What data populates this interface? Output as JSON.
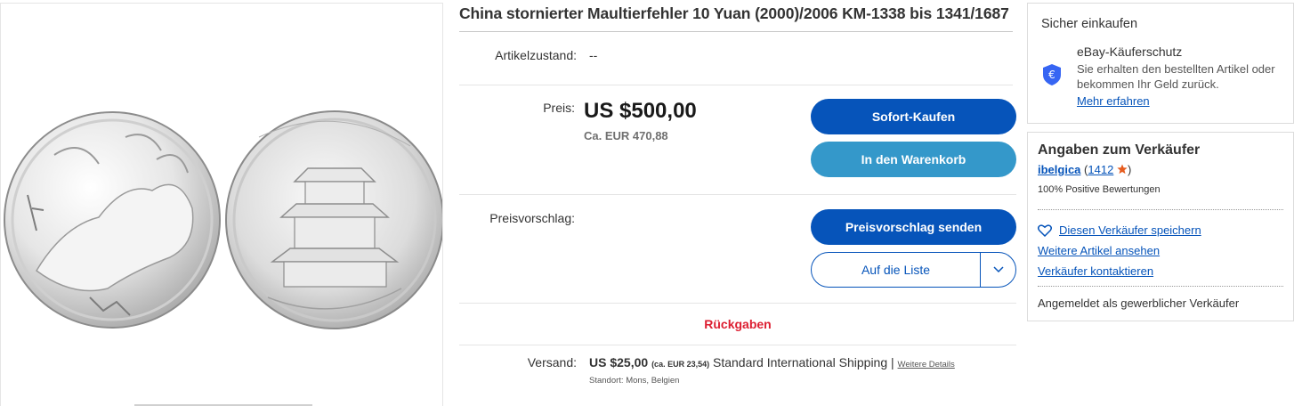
{
  "title": "China stornierter Maultierfehler 10 Yuan (2000)/2006 KM-1338 bis 1341/1687",
  "condition": {
    "label": "Artikelzustand:",
    "value": "--"
  },
  "price": {
    "label": "Preis:",
    "main": "US $500,00",
    "converted": "Ca. EUR 470,88"
  },
  "buttons": {
    "buy_now": "Sofort-Kaufen",
    "add_to_cart": "In den Warenkorb",
    "make_offer": "Preisvorschlag senden",
    "watchlist": "Auf die Liste"
  },
  "offer": {
    "label": "Preisvorschlag:"
  },
  "returns": "Rückgaben",
  "shipping": {
    "label": "Versand:",
    "amount": "US $25,00",
    "converted": "(ca. EUR 23,54)",
    "method": "Standard International Shipping |",
    "details_link": "Weitere Details",
    "location": "Standort: Mons, Belgien"
  },
  "secure": {
    "heading": "Sicher einkaufen",
    "title": "eBay-Käuferschutz",
    "text": "Sie erhalten den bestellten Artikel oder bekommen Ihr Geld zurück.",
    "link": "Mehr erfahren",
    "shield_symbol": "€"
  },
  "seller": {
    "heading": "Angaben zum Verkäufer",
    "name": "ibelgica",
    "open_paren": "(",
    "feedback": "1412",
    "close_paren": ")",
    "positive": "100% Positive Bewertungen",
    "save": "Diesen Verkäufer speichern",
    "more_items": "Weitere Artikel ansehen",
    "contact": "Verkäufer kontaktieren",
    "footer": "Angemeldet als gewerblicher Verkäufer"
  },
  "colors": {
    "primary_button": "#0654ba",
    "secondary_button": "#3498ca",
    "returns_red": "#dd1e31",
    "star_orange": "#e65c1e"
  }
}
